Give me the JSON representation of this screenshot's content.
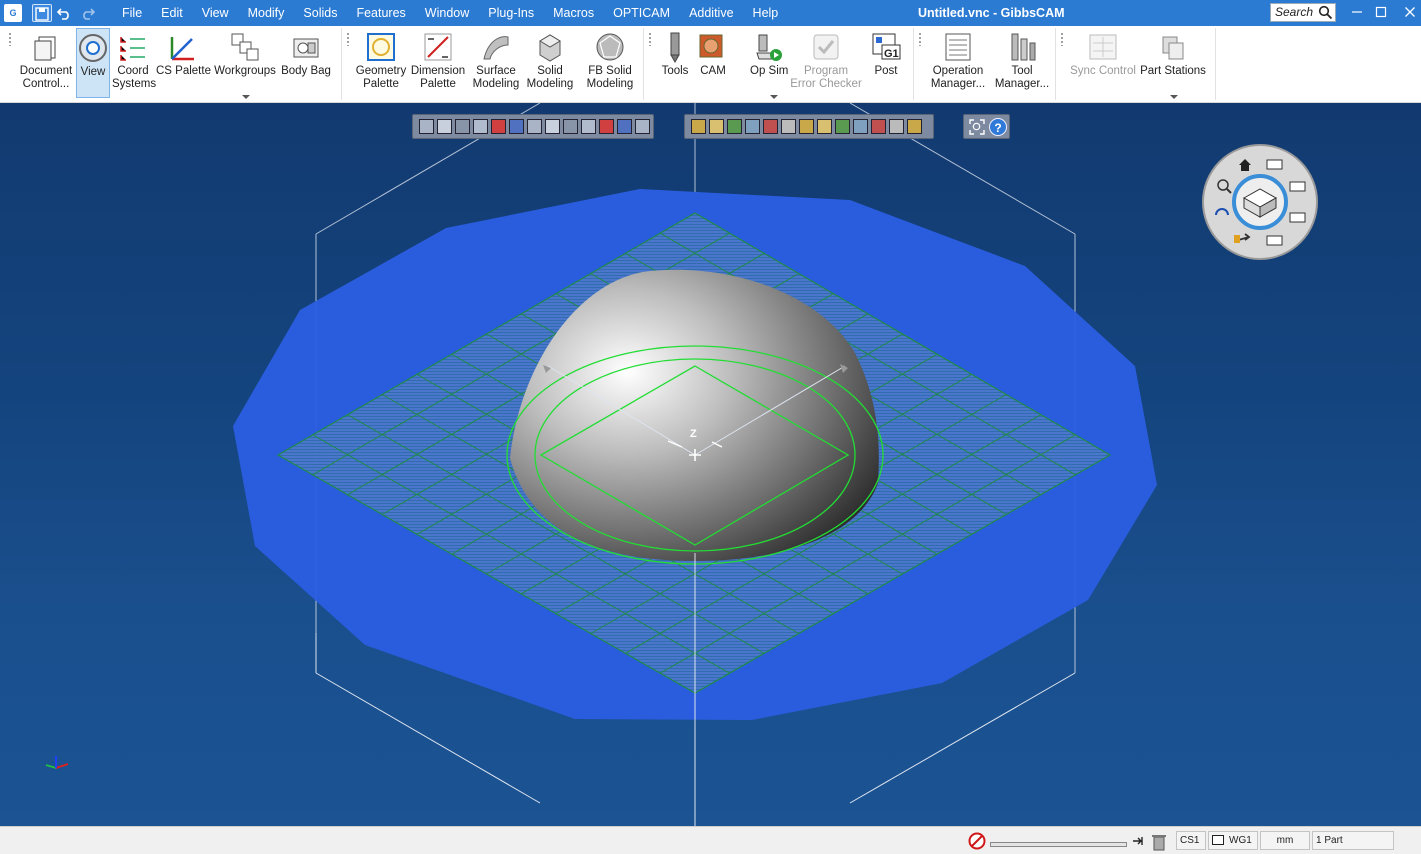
{
  "titlebar": {
    "logo_text": "G",
    "window_title": "Untitled.vnc - GibbsCAM",
    "search_placeholder": "Search",
    "min_icon": "minimize-icon",
    "max_icon": "maximize-icon",
    "close_icon": "close-icon"
  },
  "menu": [
    "File",
    "Edit",
    "View",
    "Modify",
    "Solids",
    "Features",
    "Window",
    "Plug-Ins",
    "Macros",
    "OPTICAM",
    "Additive",
    "Help"
  ],
  "ribbon": {
    "group1": [
      {
        "label": "Document\nControl...",
        "icon": "document-control-icon"
      },
      {
        "label": "View",
        "icon": "view-icon",
        "selected": true
      },
      {
        "label": "Coord\nSystems",
        "icon": "coord-systems-icon"
      },
      {
        "label": "CS Palette",
        "icon": "cs-palette-icon"
      },
      {
        "label": "Workgroups",
        "icon": "workgroups-icon"
      },
      {
        "label": "Body Bag",
        "icon": "body-bag-icon"
      }
    ],
    "group2": [
      {
        "label": "Geometry\nPalette",
        "icon": "geometry-palette-icon"
      },
      {
        "label": "Dimension\nPalette",
        "icon": "dimension-palette-icon"
      },
      {
        "label": "Surface\nModeling",
        "icon": "surface-modeling-icon"
      },
      {
        "label": "Solid\nModeling",
        "icon": "solid-modeling-icon"
      },
      {
        "label": "FB Solid\nModeling",
        "icon": "fb-solid-modeling-icon"
      }
    ],
    "group3": [
      {
        "label": "Tools",
        "icon": "tools-icon"
      },
      {
        "label": "CAM",
        "icon": "cam-icon"
      },
      {
        "label": "Op Sim",
        "icon": "op-sim-icon"
      },
      {
        "label": "Program\nError Checker",
        "icon": "error-checker-icon",
        "disabled": true
      },
      {
        "label": "Post",
        "icon": "post-icon",
        "badge": "G1"
      }
    ],
    "group4": [
      {
        "label": "Operation\nManager...",
        "icon": "operation-manager-icon"
      },
      {
        "label": "Tool\nManager...",
        "icon": "tool-manager-icon"
      }
    ],
    "group5": [
      {
        "label": "Sync Control",
        "icon": "sync-control-icon",
        "disabled": true
      },
      {
        "label": "Part Stations",
        "icon": "part-stations-icon"
      }
    ]
  },
  "viewport": {
    "origin_label": "Z",
    "help_icon_text": "?",
    "colors": {
      "background": "#14447e",
      "stock": "#2b5ee0",
      "grid": "#1f8a4a",
      "contour": "#22dd33",
      "dome": "#c9c9c9"
    }
  },
  "statusbar": {
    "cs_label": "CS1",
    "wg_label": "WG1",
    "units": "mm",
    "parts": "1 Part"
  }
}
